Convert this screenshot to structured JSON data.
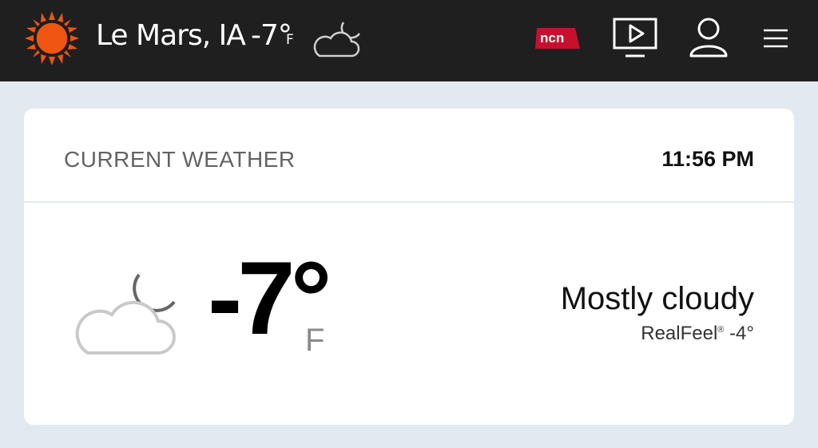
{
  "header": {
    "city": "Le Mars, IA",
    "temp": "-7°",
    "unit": "F",
    "weather_icon": "cloud-moon-icon",
    "brand_icon": "sun-logo-icon",
    "partner_logo_text": "ncn",
    "icons": [
      "video-icon",
      "user-icon",
      "menu-icon"
    ]
  },
  "card": {
    "title": "CURRENT WEATHER",
    "time": "11:56 PM",
    "temp": "-7°",
    "unit": "F",
    "phrase": "Mostly cloudy",
    "realfeel_label": "RealFeel",
    "realfeel_mark": "®",
    "realfeel_value": "-4°"
  },
  "colors": {
    "topbar": "#1f1f1f",
    "accent_orange": "#f05514",
    "page_bg": "#e3e9f1",
    "card_bg": "#ffffff"
  }
}
